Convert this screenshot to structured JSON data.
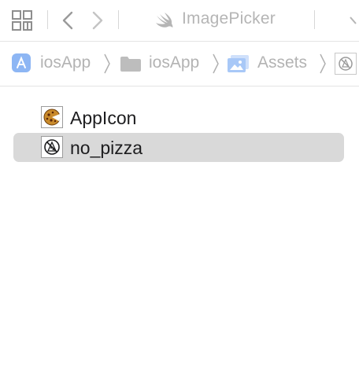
{
  "toolbar": {
    "title": "ImagePicker",
    "icons": [
      "grid-icon",
      "chevron-left-icon",
      "chevron-right-icon",
      "swift-icon"
    ]
  },
  "breadcrumb": [
    {
      "label": "iosApp",
      "icon": "app-project-icon"
    },
    {
      "label": "iosApp",
      "icon": "folder-icon"
    },
    {
      "label": "Assets",
      "icon": "asset-catalog-icon"
    },
    {
      "label": "",
      "icon": "no-pizza-thumb-icon"
    }
  ],
  "assets": [
    {
      "label": "AppIcon",
      "icon": "pizza-thumb-icon",
      "selected": false
    },
    {
      "label": "no_pizza",
      "icon": "no-pizza-thumb-icon",
      "selected": true
    }
  ],
  "colors": {
    "accent": "#4a8ff6",
    "selection": "#d9d9d9",
    "muted_text": "#b3b3b3"
  }
}
